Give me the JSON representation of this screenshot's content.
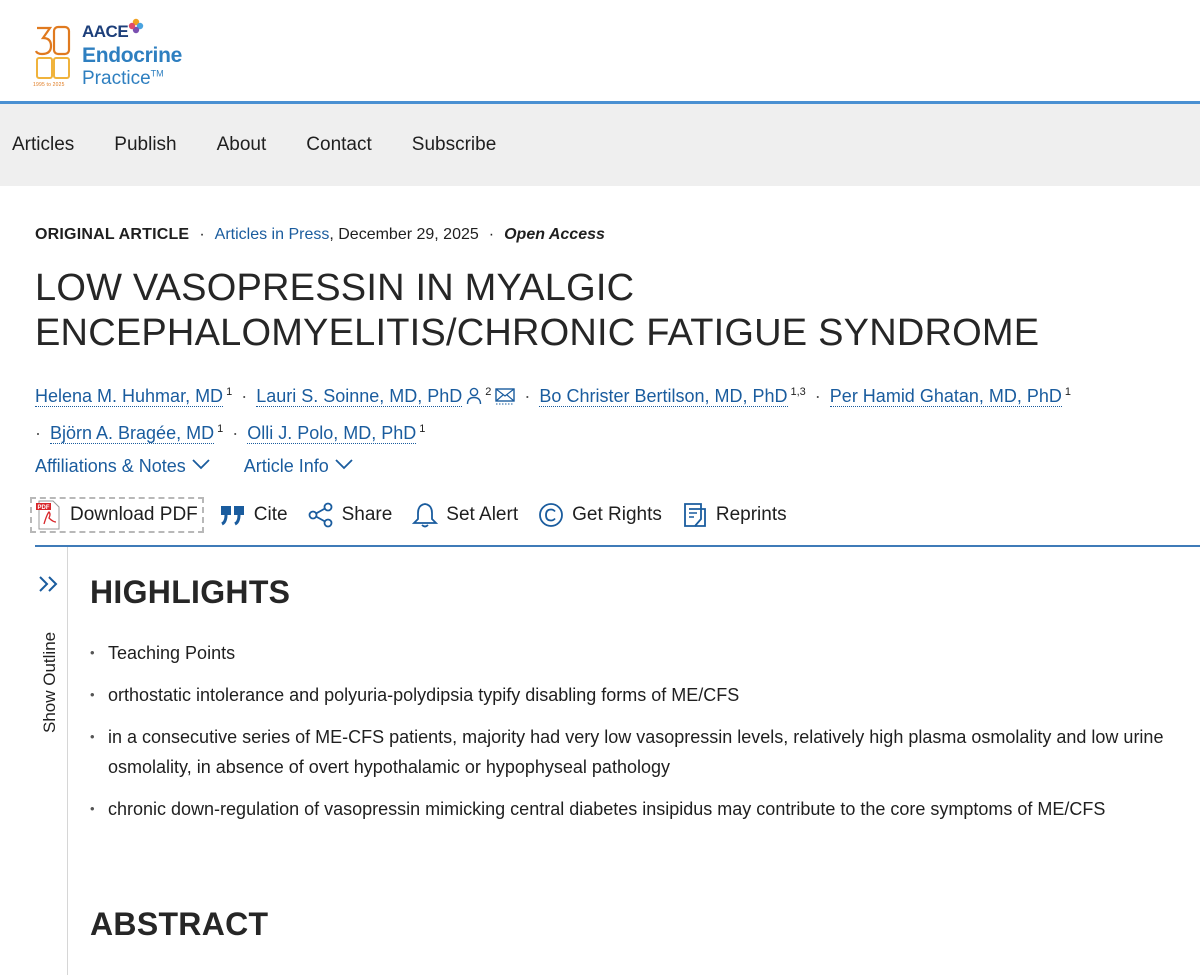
{
  "brand": {
    "aace": "AACE",
    "name_line1": "Endocrine",
    "name_line2": "Practice",
    "trademark": "TM",
    "years": "1995 to 2025",
    "colors": {
      "navy": "#1d3f7a",
      "blue": "#2e7fc0",
      "orange": "#e07a1f",
      "rule": "#4a90d2"
    }
  },
  "nav": {
    "items": [
      "Articles",
      "Publish",
      "About",
      "Contact",
      "Subscribe"
    ]
  },
  "meta": {
    "type": "ORIGINAL ARTICLE",
    "section": "Articles in Press",
    "date": ", December 29, 2025",
    "access": "Open Access"
  },
  "title_line1": "LOW VASOPRESSIN IN MYALGIC",
  "title_line2": "ENCEPHALOMYELITIS/CHRONIC FATIGUE SYNDROME",
  "authors": [
    {
      "name": "Helena M. Huhmar, MD",
      "sup": "1"
    },
    {
      "name": "Lauri S. Soinne, MD, PhD",
      "sup": "2"
    },
    {
      "name": "Bo Christer Bertilson, MD, PhD",
      "sup": "1,3"
    },
    {
      "name": "Per Hamid Ghatan, MD, PhD",
      "sup": "1"
    },
    {
      "name": "Björn A. Bragée, MD",
      "sup": "1"
    },
    {
      "name": "Olli J. Polo, MD, PhD",
      "sup": "1"
    }
  ],
  "expanders": {
    "affiliations": "Affiliations & Notes",
    "article_info": "Article Info"
  },
  "toolbar": {
    "download": "Download PDF",
    "cite": "Cite",
    "share": "Share",
    "alert": "Set Alert",
    "rights": "Get Rights",
    "reprints": "Reprints",
    "pdf_badge": "PDF"
  },
  "outline": {
    "label": "Show Outline"
  },
  "highlights": {
    "heading": "HIGHLIGHTS",
    "items": [
      "Teaching Points",
      "orthostatic intolerance and polyuria-polydipsia typify disabling forms of ME/CFS",
      "in a consecutive series of ME-CFS patients, majority had very low vasopressin levels, relatively high plasma osmolality and low urine osmolality, in absence of overt hypothalamic or hypophyseal pathology",
      "chronic down-regulation of vasopressin mimicking central diabetes insipidus may contribute to the core symptoms of ME/CFS"
    ]
  },
  "abstract": {
    "heading": "ABSTRACT"
  },
  "link_color": "#1a5c9e"
}
